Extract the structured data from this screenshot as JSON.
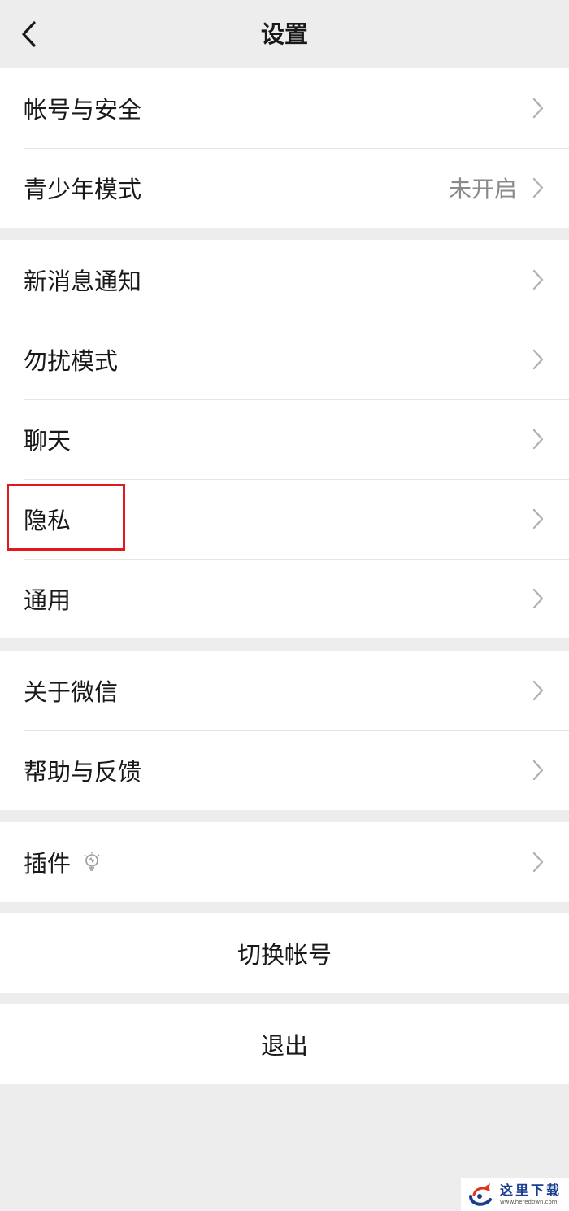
{
  "nav": {
    "title": "设置"
  },
  "groups": [
    {
      "items": [
        {
          "label": "帐号与安全",
          "value": ""
        },
        {
          "label": "青少年模式",
          "value": "未开启"
        }
      ]
    },
    {
      "items": [
        {
          "label": "新消息通知",
          "value": ""
        },
        {
          "label": "勿扰模式",
          "value": ""
        },
        {
          "label": "聊天",
          "value": ""
        },
        {
          "label": "隐私",
          "value": ""
        },
        {
          "label": "通用",
          "value": ""
        }
      ]
    },
    {
      "items": [
        {
          "label": "关于微信",
          "value": ""
        },
        {
          "label": "帮助与反馈",
          "value": ""
        }
      ]
    },
    {
      "items": [
        {
          "label": "插件",
          "value": "",
          "icon": "lightbulb-icon"
        }
      ]
    }
  ],
  "actions": {
    "switch_account": "切换帐号",
    "logout": "退出"
  },
  "watermark": {
    "title": "这里下载",
    "url": "www.heredown.com"
  },
  "colors": {
    "background": "#ededed",
    "card": "#ffffff",
    "text": "#191919",
    "secondary_text": "#8a8a8a",
    "highlight": "#e1191e"
  }
}
